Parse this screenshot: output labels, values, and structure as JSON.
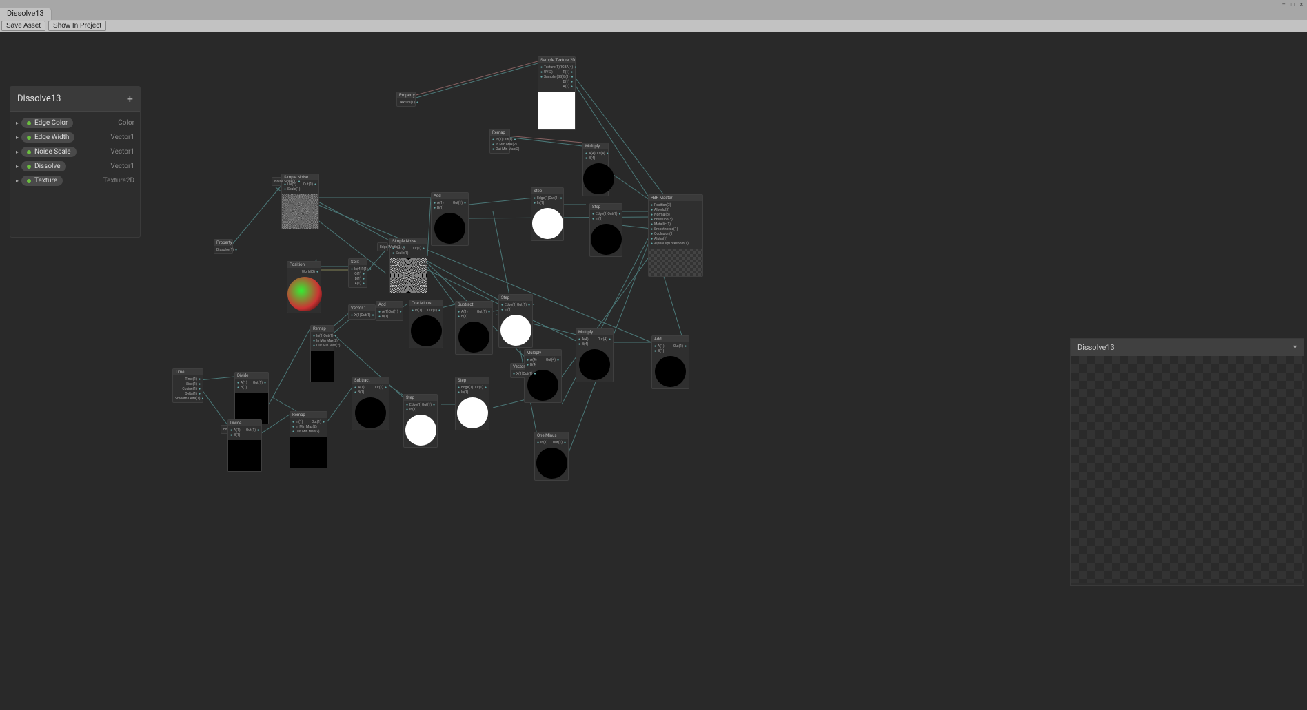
{
  "window": {
    "minimize": "–",
    "maximize": "□",
    "close": "×"
  },
  "tab": "Dissolve13",
  "toolbar": {
    "save_label": "Save Asset",
    "show_label": "Show In Project"
  },
  "blackboard": {
    "title": "Dissolve13",
    "plus": "+",
    "properties": [
      {
        "name": "Edge Color",
        "type": "Color"
      },
      {
        "name": "Edge Width",
        "type": "Vector1"
      },
      {
        "name": "Noise Scale",
        "type": "Vector1"
      },
      {
        "name": "Dissolve",
        "type": "Vector1"
      },
      {
        "name": "Texture",
        "type": "Texture2D"
      }
    ]
  },
  "preview": {
    "title": "Dissolve13"
  },
  "nodes": {
    "sampletex": {
      "title": "Sample Texture 2D",
      "ins": [
        "Texture(T)",
        "UV(2)",
        "Sampler(SS)"
      ],
      "outs": [
        "RGBA(4)",
        "R(1)",
        "G(1)",
        "B(1)",
        "A(1)"
      ]
    },
    "property_tex": {
      "title": "Property",
      "outs": [
        "Texture(T)"
      ]
    },
    "simplenoise": {
      "title": "Simple Noise",
      "ins": [
        "UV(2)",
        "Scale(1)"
      ],
      "outs": [
        "Out(1)"
      ]
    },
    "property_scale": {
      "title": "Property",
      "outs": [
        "Noise Scale(1)"
      ]
    },
    "remap": {
      "title": "Remap",
      "ins": [
        "In(1)",
        "In Min Max(2)",
        "Out Min Max(2)"
      ],
      "outs": [
        "Out(1)"
      ]
    },
    "multiply": {
      "title": "Multiply",
      "ins": [
        "A(4)",
        "B(4)"
      ],
      "outs": [
        "Out(4)"
      ]
    },
    "add": {
      "title": "Add",
      "ins": [
        "A(1)",
        "B(1)"
      ],
      "outs": [
        "Out(1)"
      ]
    },
    "step": {
      "title": "Step",
      "ins": [
        "Edge(1)",
        "In(1)"
      ],
      "outs": [
        "Out(1)"
      ]
    },
    "subtract": {
      "title": "Subtract",
      "ins": [
        "A(1)",
        "B(1)"
      ],
      "outs": [
        "Out(1)"
      ]
    },
    "oneminus": {
      "title": "One Minus",
      "ins": [
        "In(1)"
      ],
      "outs": [
        "Out(1)"
      ]
    },
    "position": {
      "title": "Position",
      "outs": [
        "World(3)"
      ]
    },
    "split": {
      "title": "Split",
      "ins": [
        "In(4)"
      ],
      "outs": [
        "R(1)",
        "G(1)",
        "B(1)",
        "A(1)"
      ]
    },
    "time": {
      "title": "Time",
      "outs": [
        "Time(1)",
        "Sine(1)",
        "Cosine(1)",
        "Delta(1)",
        "Smooth Delta(1)"
      ]
    },
    "divide": {
      "title": "Divide",
      "ins": [
        "A(1)",
        "B(1)"
      ],
      "outs": [
        "Out(1)"
      ]
    },
    "vector1": {
      "title": "Vector 1",
      "ins": [
        "X(1)"
      ],
      "outs": [
        "Out(1)"
      ]
    },
    "master": {
      "title": "PBR Master",
      "ins": [
        "Position(3)",
        "Albedo(3)",
        "Normal(3)",
        "Emission(3)",
        "Metallic(1)",
        "Smoothness(1)",
        "Occlusion(1)",
        "Alpha(1)",
        "AlphaClipThreshold(1)"
      ]
    },
    "property_dissolve": {
      "title": "Property",
      "outs": [
        "Dissolve(1)"
      ]
    },
    "property_width": {
      "title": "Property",
      "outs": [
        "Edge Width(1)"
      ]
    },
    "property_color": {
      "title": "Property",
      "outs": [
        "Edge Color(4)"
      ]
    }
  }
}
